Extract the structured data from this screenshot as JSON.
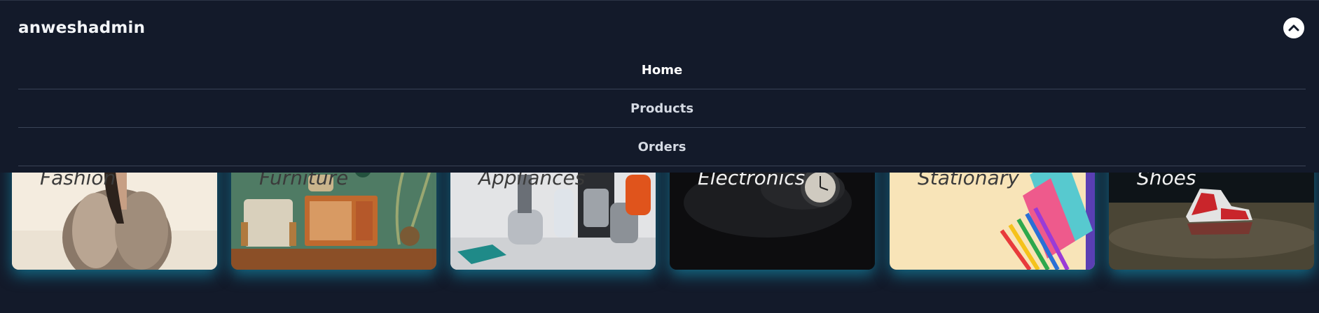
{
  "navbar": {
    "brand": "anweshadmin",
    "toggle_icon": "chevron-up-icon",
    "menu": [
      {
        "label": "Home",
        "active": true
      },
      {
        "label": "Products",
        "active": false
      },
      {
        "label": "Orders",
        "active": false
      }
    ]
  },
  "categories": [
    {
      "label": "Fashion",
      "image": "woman in fur coat"
    },
    {
      "label": "Furniture",
      "image": "armchair and wooden cabinet"
    },
    {
      "label": "Appliances",
      "image": "kitchen appliances"
    },
    {
      "label": "Electronics",
      "image": "pocket watch in smoke"
    },
    {
      "label": "Stationary",
      "image": "colored pencils and notebook"
    },
    {
      "label": "Shoes",
      "image": "sneaker on wet street"
    }
  ],
  "colors": {
    "background": "#131a2a",
    "glow": "#14aacd",
    "divider": "#3a4356"
  }
}
